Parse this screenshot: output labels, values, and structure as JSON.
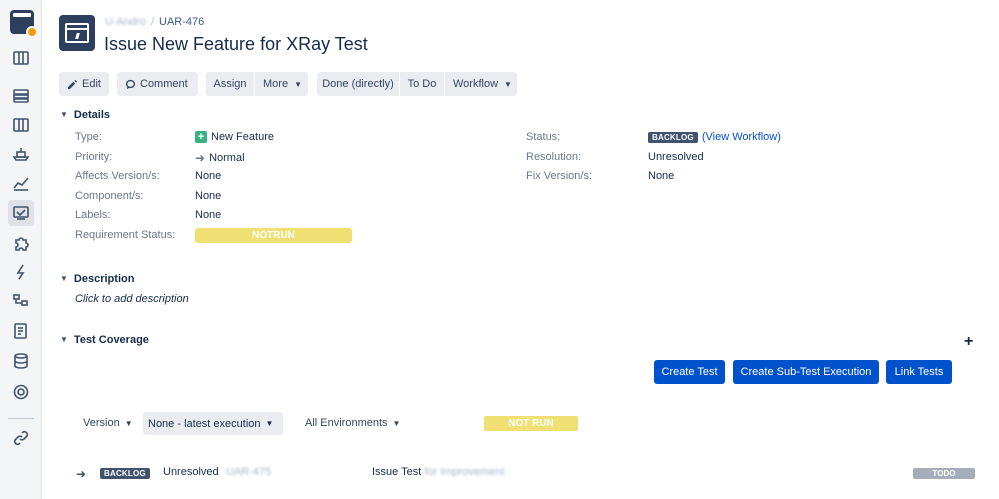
{
  "breadcrumb": {
    "project": "U-Andro",
    "issue_key": "UAR-476"
  },
  "issue": {
    "title": "Issue New Feature for XRay Test"
  },
  "toolbar": {
    "edit": "Edit",
    "comment": "Comment",
    "assign": "Assign",
    "more": "More",
    "done": "Done (directly)",
    "todo": "To Do",
    "workflow": "Workflow"
  },
  "details": {
    "heading": "Details",
    "type_label": "Type:",
    "type_value": "New Feature",
    "priority_label": "Priority:",
    "priority_value": "Normal",
    "affects_label": "Affects Version/s:",
    "affects_value": "None",
    "component_label": "Component/s:",
    "component_value": "None",
    "labels_label": "Labels:",
    "labels_value": "None",
    "req_status_label": "Requirement Status:",
    "req_status_value": "NOTRUN",
    "status_label": "Status:",
    "status_value": "BACKLOG",
    "view_workflow": "(View Workflow)",
    "resolution_label": "Resolution:",
    "resolution_value": "Unresolved",
    "fix_label": "Fix Version/s:",
    "fix_value": "None"
  },
  "description": {
    "heading": "Description",
    "placeholder": "Click to add description"
  },
  "test_coverage": {
    "heading": "Test Coverage",
    "create_test": "Create Test",
    "create_sub": "Create Sub-Test Execution",
    "link_tests": "Link Tests",
    "version_label": "Version",
    "version_select": "None - latest execution",
    "environments": "All Environments",
    "overall_status": "NOT RUN",
    "row": {
      "status": "BACKLOG",
      "resolution": "Unresolved",
      "key": "UAR-475",
      "summary_prefix": "Issue Test",
      "summary_rest": "for Improvement",
      "test_status": "TODO"
    }
  },
  "colors": {
    "primary": "#0052cc",
    "notrun": "#f0e073",
    "lozenge": "#42526e",
    "sidebar": "#f4f5f7"
  }
}
